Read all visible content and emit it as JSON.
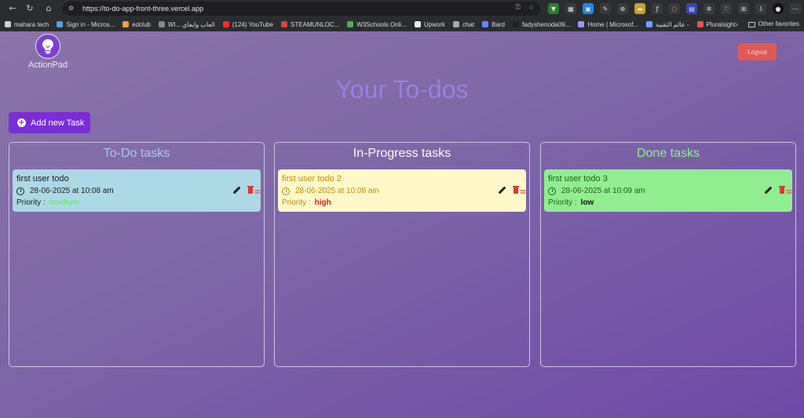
{
  "browser": {
    "url": "https://to-do-app-front-three.vercel.app",
    "bookmarks": [
      {
        "label": "mahara tech",
        "color": "#cfcfcf"
      },
      {
        "label": "Sign in - Micros...",
        "color": "#4aa3e8"
      },
      {
        "label": "edclub",
        "color": "#f3a03a"
      },
      {
        "label": "Wl... العاب وايفاي",
        "color": "#888888"
      },
      {
        "label": "(124) YouTube",
        "color": "#ff2a2a"
      },
      {
        "label": "STEAMUNLOC...",
        "color": "#e04040"
      },
      {
        "label": "W3Schools Onli...",
        "color": "#4caf50"
      },
      {
        "label": "Upwork",
        "color": "#eeeeee"
      },
      {
        "label": "chat",
        "color": "#aaaaaa"
      },
      {
        "label": "Bard",
        "color": "#5a8cff"
      },
      {
        "label": "fadyshenoda09...",
        "color": "#222222"
      },
      {
        "label": "Home | Microsof...",
        "color": "#9a9aff"
      },
      {
        "label": "عالم التقنية -",
        "color": "#6fa0ff"
      },
      {
        "label": "Pluralsight",
        "color": "#ff4d4d"
      }
    ],
    "other_favorites": "Other favorites"
  },
  "app": {
    "logo_text": "ActionPad",
    "logout_label": "Logout",
    "page_title": "Your To-dos",
    "add_task_label": "Add new Task"
  },
  "columns": [
    {
      "title": "To-Do tasks",
      "title_color": "#a9c8f0",
      "card": {
        "title": "first user todo",
        "date": "28-06-2025 at 10:08 am",
        "priority_label": "Priority :",
        "priority_value": "medium",
        "bg": "#add8e6",
        "text_color": "#1a1a1a",
        "priority_color": "#6fe86f"
      }
    },
    {
      "title": "In-Progress tasks",
      "title_color": "#ffffff",
      "card": {
        "title": "first user todo 2",
        "date": "28-06-2025 at 10:08 am",
        "priority_label": "Priority :",
        "priority_value": "high",
        "bg": "#fff8c8",
        "text_color": "#c88a10",
        "priority_color": "#d42020"
      }
    },
    {
      "title": "Done tasks",
      "title_color": "#8fef8f",
      "card": {
        "title": "first user todo 3",
        "date": "28-06-2025 at 10:09 am",
        "priority_label": "Priority :",
        "priority_value": "low",
        "bg": "#90ee90",
        "text_color": "#1b5e1b",
        "priority_color": "#111111"
      }
    }
  ]
}
